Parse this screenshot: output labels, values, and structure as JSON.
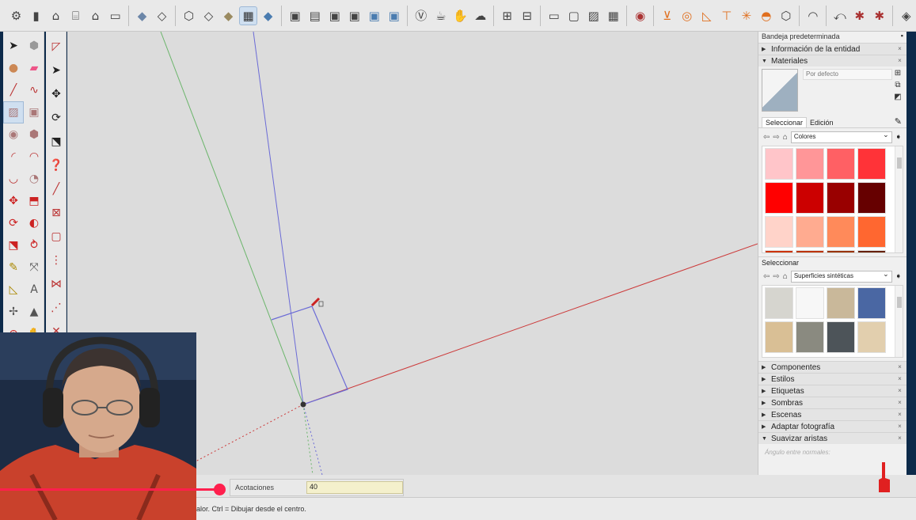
{
  "app": "SketchUp",
  "toolbar_top": {
    "icons": [
      "getting-started-icon",
      "book-icon",
      "home-icon",
      "warehouse-icon",
      "home-outline-icon",
      "box-icon",
      "xray-icon",
      "backedges-icon",
      "wireframe-icon",
      "hiddenline-icon",
      "shaded-icon",
      "shaded-textures-icon",
      "monochrome-icon",
      "iso-view-icon",
      "top-view-icon",
      "front-view-icon",
      "right-view-icon",
      "back-view-icon",
      "left-view-icon",
      "vray-icon",
      "teapot-icon",
      "hand-icon",
      "cloud-icon",
      "sandbox-icon",
      "section-icon",
      "window-icon",
      "frame-icon",
      "image-icon",
      "grid-icon",
      "ruby-icon",
      "measure-tool-icon",
      "circle-tool-icon",
      "protractor-icon",
      "axes-icon",
      "sun-icon",
      "dome-icon",
      "cube-icon",
      "curve-icon",
      "eraser-icon",
      "extension-icon",
      "extension2-icon",
      "components-icon"
    ]
  },
  "measurements": {
    "label": "Acotaciones",
    "value": "40"
  },
  "status": {
    "hint": "alor. Ctrl = Dibujar desde el centro."
  },
  "tray": {
    "title": "Bandeja predeterminada",
    "entity_info": "Información de la entidad",
    "materials": {
      "title": "Materiales",
      "name_placeholder": "Por defecto",
      "tab_select": "Seleccionar",
      "tab_edit": "Edición",
      "collection": "Colores",
      "colors": [
        "#ffc5c9",
        "#ff9698",
        "#ff6064",
        "#ff3338",
        "#ff0000",
        "#cc0000",
        "#990000",
        "#660000",
        "#ffd3c9",
        "#ffab90",
        "#ff8a5a",
        "#ff6730",
        "#cc3300",
        "#bb3300",
        "#993300",
        "#662000"
      ],
      "secondary_label": "Seleccionar",
      "secondary_collection": "Superficies sintéticas",
      "synthetic": [
        "#d6d5cf",
        "#f7f7f7",
        "#c9b89a",
        "#4a67a3",
        "#d9bf95",
        "#8a8a80",
        "#4d5459",
        "#e2cfae"
      ]
    },
    "collapsed_panels": [
      "Componentes",
      "Estilos",
      "Etiquetas",
      "Sombras",
      "Escenas",
      "Adaptar fotografía"
    ],
    "soften": {
      "title": "Suavizar aristas",
      "angle_label": "Ángulo entre normales:"
    }
  },
  "colors": {
    "green_axis": "#6bb56b",
    "blue_axis": "#6b6bd6",
    "red_axis": "#cc3a3a",
    "progress": "#ff1f4d"
  }
}
